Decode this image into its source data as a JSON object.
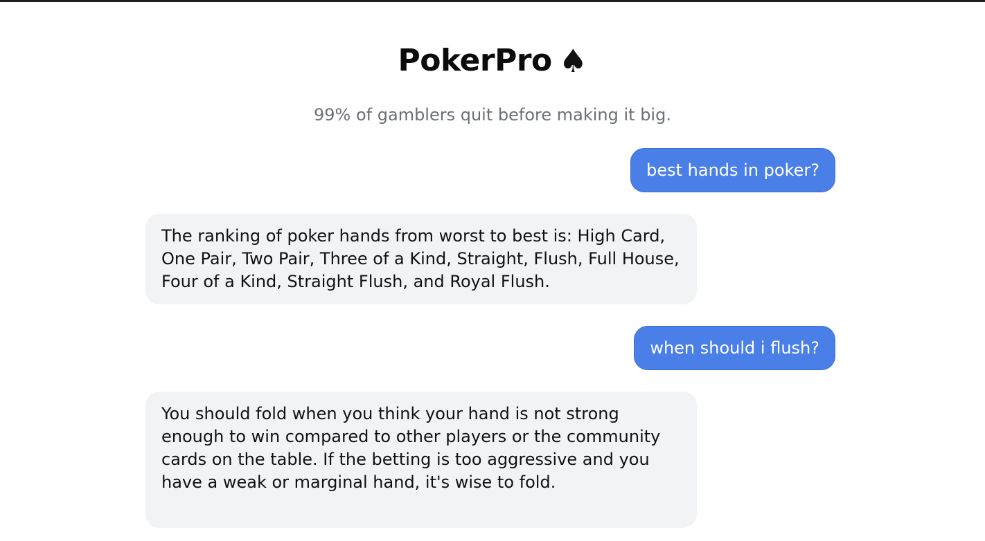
{
  "app": {
    "title": "PokerPro",
    "title_icon": "spade-icon",
    "subtitle": "99% of gamblers quit before making it big."
  },
  "messages": [
    {
      "role": "user",
      "text": "best hands in poker?"
    },
    {
      "role": "assistant",
      "text": "The ranking of poker hands from worst to best is: High Card, One Pair, Two Pair, Three of a Kind, Straight, Flush, Full House, Four of a Kind, Straight Flush, and Royal Flush."
    },
    {
      "role": "user",
      "text": "when should i flush?"
    },
    {
      "role": "assistant",
      "text": "You should fold when you think your hand is not strong enough to win compared to other players or the community cards on the table. If the betting is too aggressive and you have a weak or marginal hand, it's wise to fold."
    }
  ],
  "colors": {
    "user_bubble": "#4a7fe8",
    "assistant_bubble": "#f2f3f5",
    "subtitle_text": "#6b6f76"
  }
}
